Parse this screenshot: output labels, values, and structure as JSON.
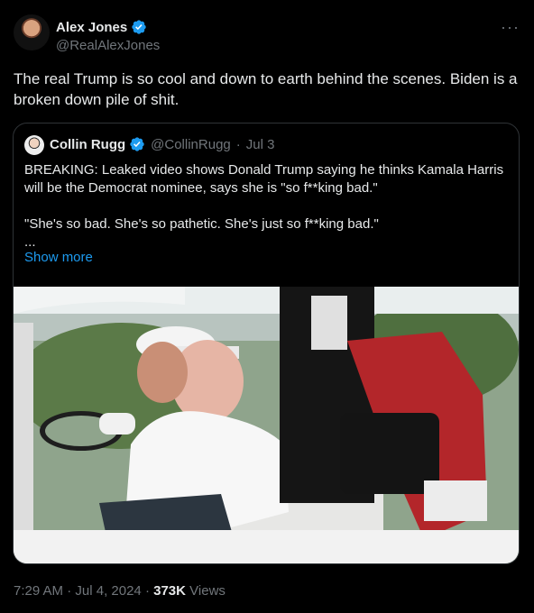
{
  "author": {
    "name": "Alex Jones",
    "handle": "@RealAlexJones"
  },
  "post_text": "The real Trump is so cool and down to earth behind the scenes. Biden is a broken down pile of shit.",
  "quoted": {
    "name": "Collin Rugg",
    "handle": "@CollinRugg",
    "date": "Jul 3",
    "text": "BREAKING: Leaked video shows Donald Trump saying he thinks Kamala Harris will be the Democrat nominee, says she is \"so f**king bad.\"\n\n\"She's so bad. She's so pathetic. She's just so f**king bad.\"\n...",
    "show_more": "Show more"
  },
  "meta": {
    "time": "7:29 AM",
    "date": "Jul 4, 2024",
    "views": "373K",
    "views_label": "Views"
  },
  "icons": {
    "more": "more-horizontal-icon",
    "verified": "verified-badge-icon"
  },
  "colors": {
    "accent": "#1d9bf0",
    "muted": "#71767b"
  }
}
